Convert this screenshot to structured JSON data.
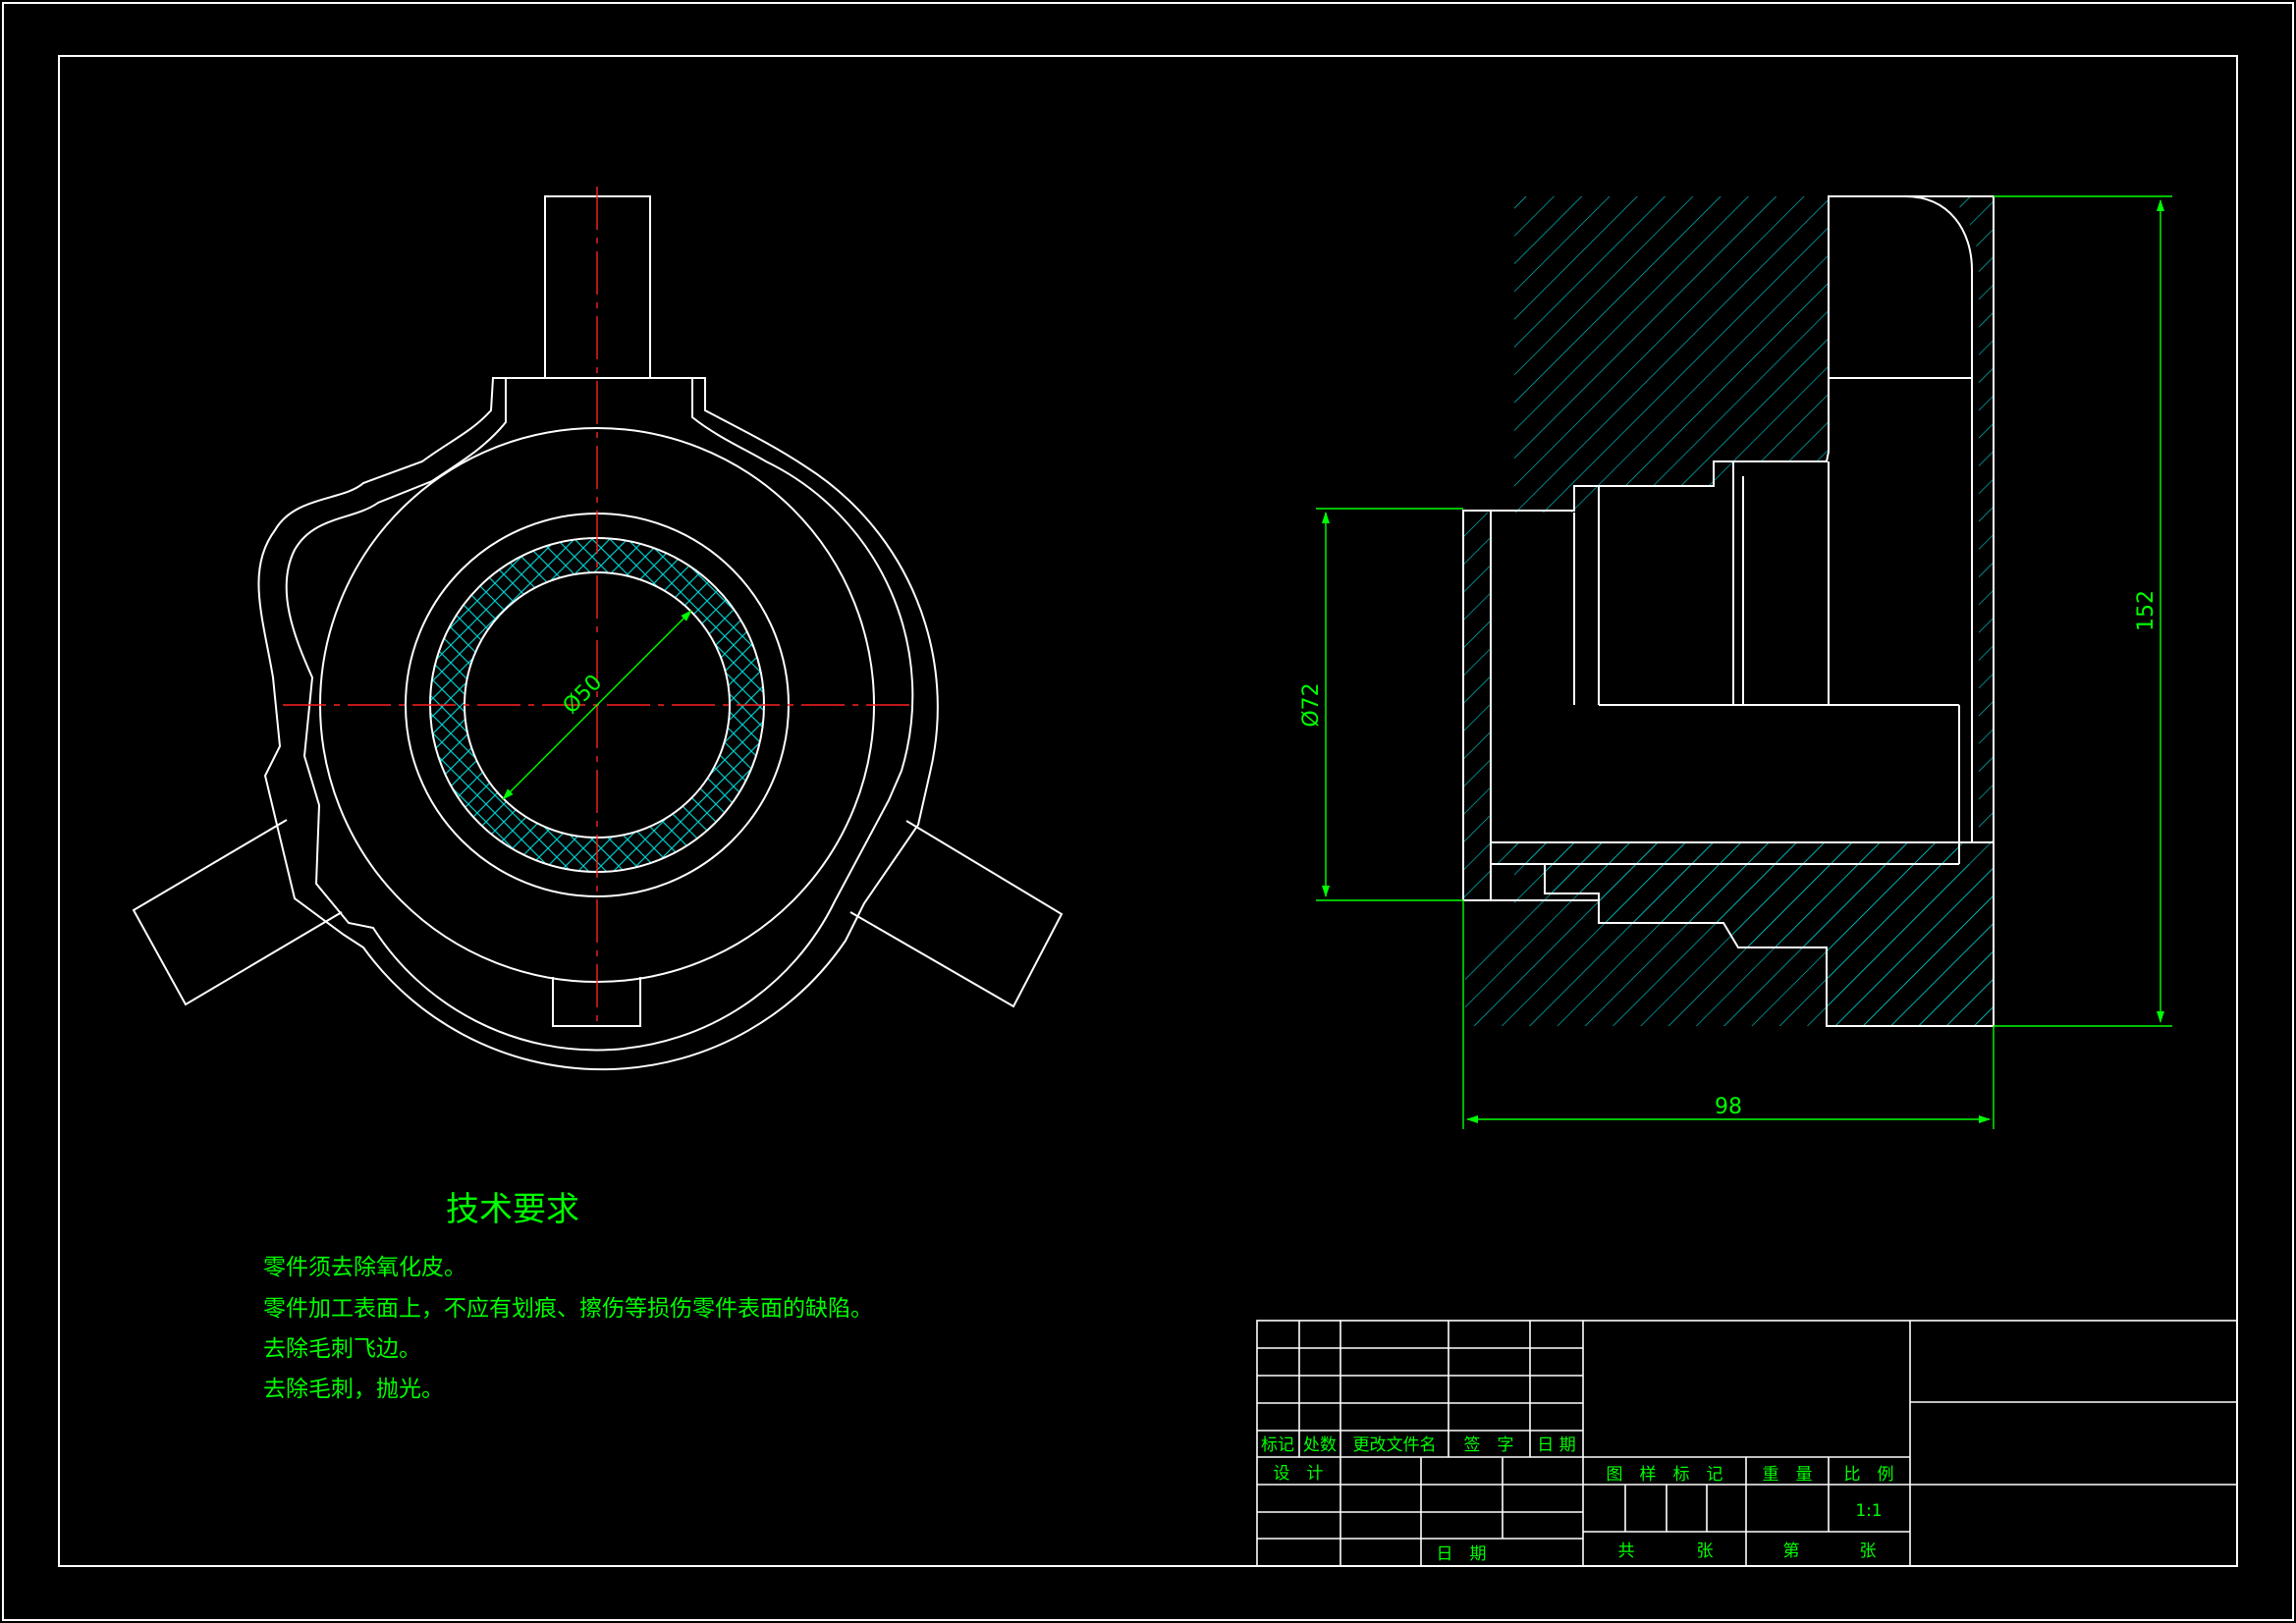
{
  "dimensions": {
    "inner_diameter": "Ø50",
    "outer_diameter": "Ø72",
    "height": "152",
    "length": "98"
  },
  "tech_requirements": {
    "title": "技术要求",
    "items": [
      "零件须去除氧化皮。",
      "零件加工表面上，不应有划痕、擦伤等损伤零件表面的缺陷。",
      "去除毛刺飞边。",
      "去除毛刺，抛光。"
    ]
  },
  "title_block": {
    "header_labels": [
      "标记",
      "处数",
      "更改文件名",
      "签　字",
      "日 期"
    ],
    "design_label": "设　计",
    "date_label": "日　期",
    "drawing_mark_label": "图　样　标　记",
    "weight_label": "重　量",
    "scale_label": "比　例",
    "scale_value": "1:1",
    "total_label": "共",
    "sheet_label": "张",
    "sheet_no_label": "第",
    "sheet_no_suffix": "张"
  },
  "colors": {
    "background": "#000000",
    "geometry": "#ffffff",
    "center_line": "#ff2020",
    "dimension": "#00ff00",
    "hatch": "#00c8c8"
  }
}
